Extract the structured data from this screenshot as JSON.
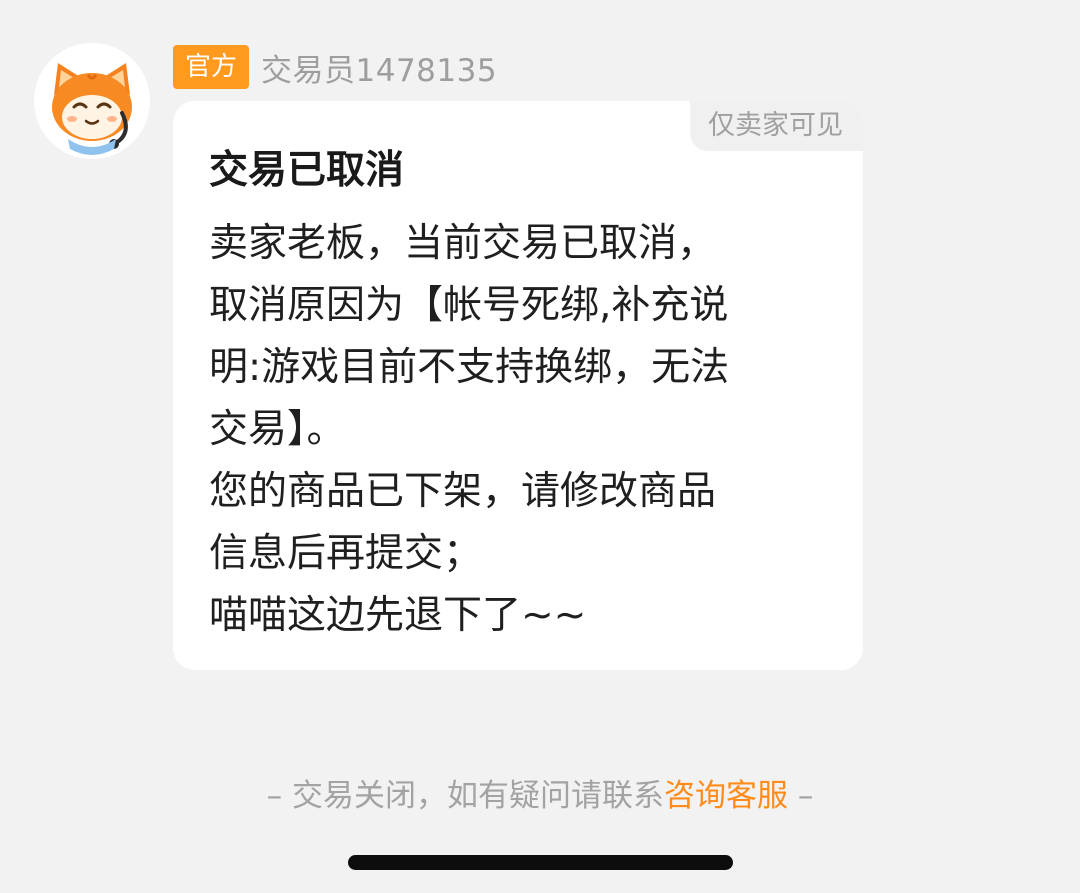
{
  "sender": {
    "avatar_icon": "cat-customer-service-icon",
    "badge": "官方",
    "name": "交易员1478135"
  },
  "message": {
    "visibility": "仅卖家可见",
    "title": "交易已取消",
    "lines": [
      "卖家老板，当前交易已取消，",
      "取消原因为【帐号死绑,补充说",
      "明:游戏目前不支持换绑，无法",
      "交易】。",
      "您的商品已下架，请修改商品",
      "信息后再提交；",
      "喵喵这边先退下了~~"
    ]
  },
  "footer": {
    "prefix": "– 交易关闭，如有疑问请联系",
    "link": "咨询客服",
    "suffix": " –"
  },
  "colors": {
    "accent": "#ff9a1f",
    "link": "#ff8c1a",
    "background": "#f2f2f2"
  }
}
